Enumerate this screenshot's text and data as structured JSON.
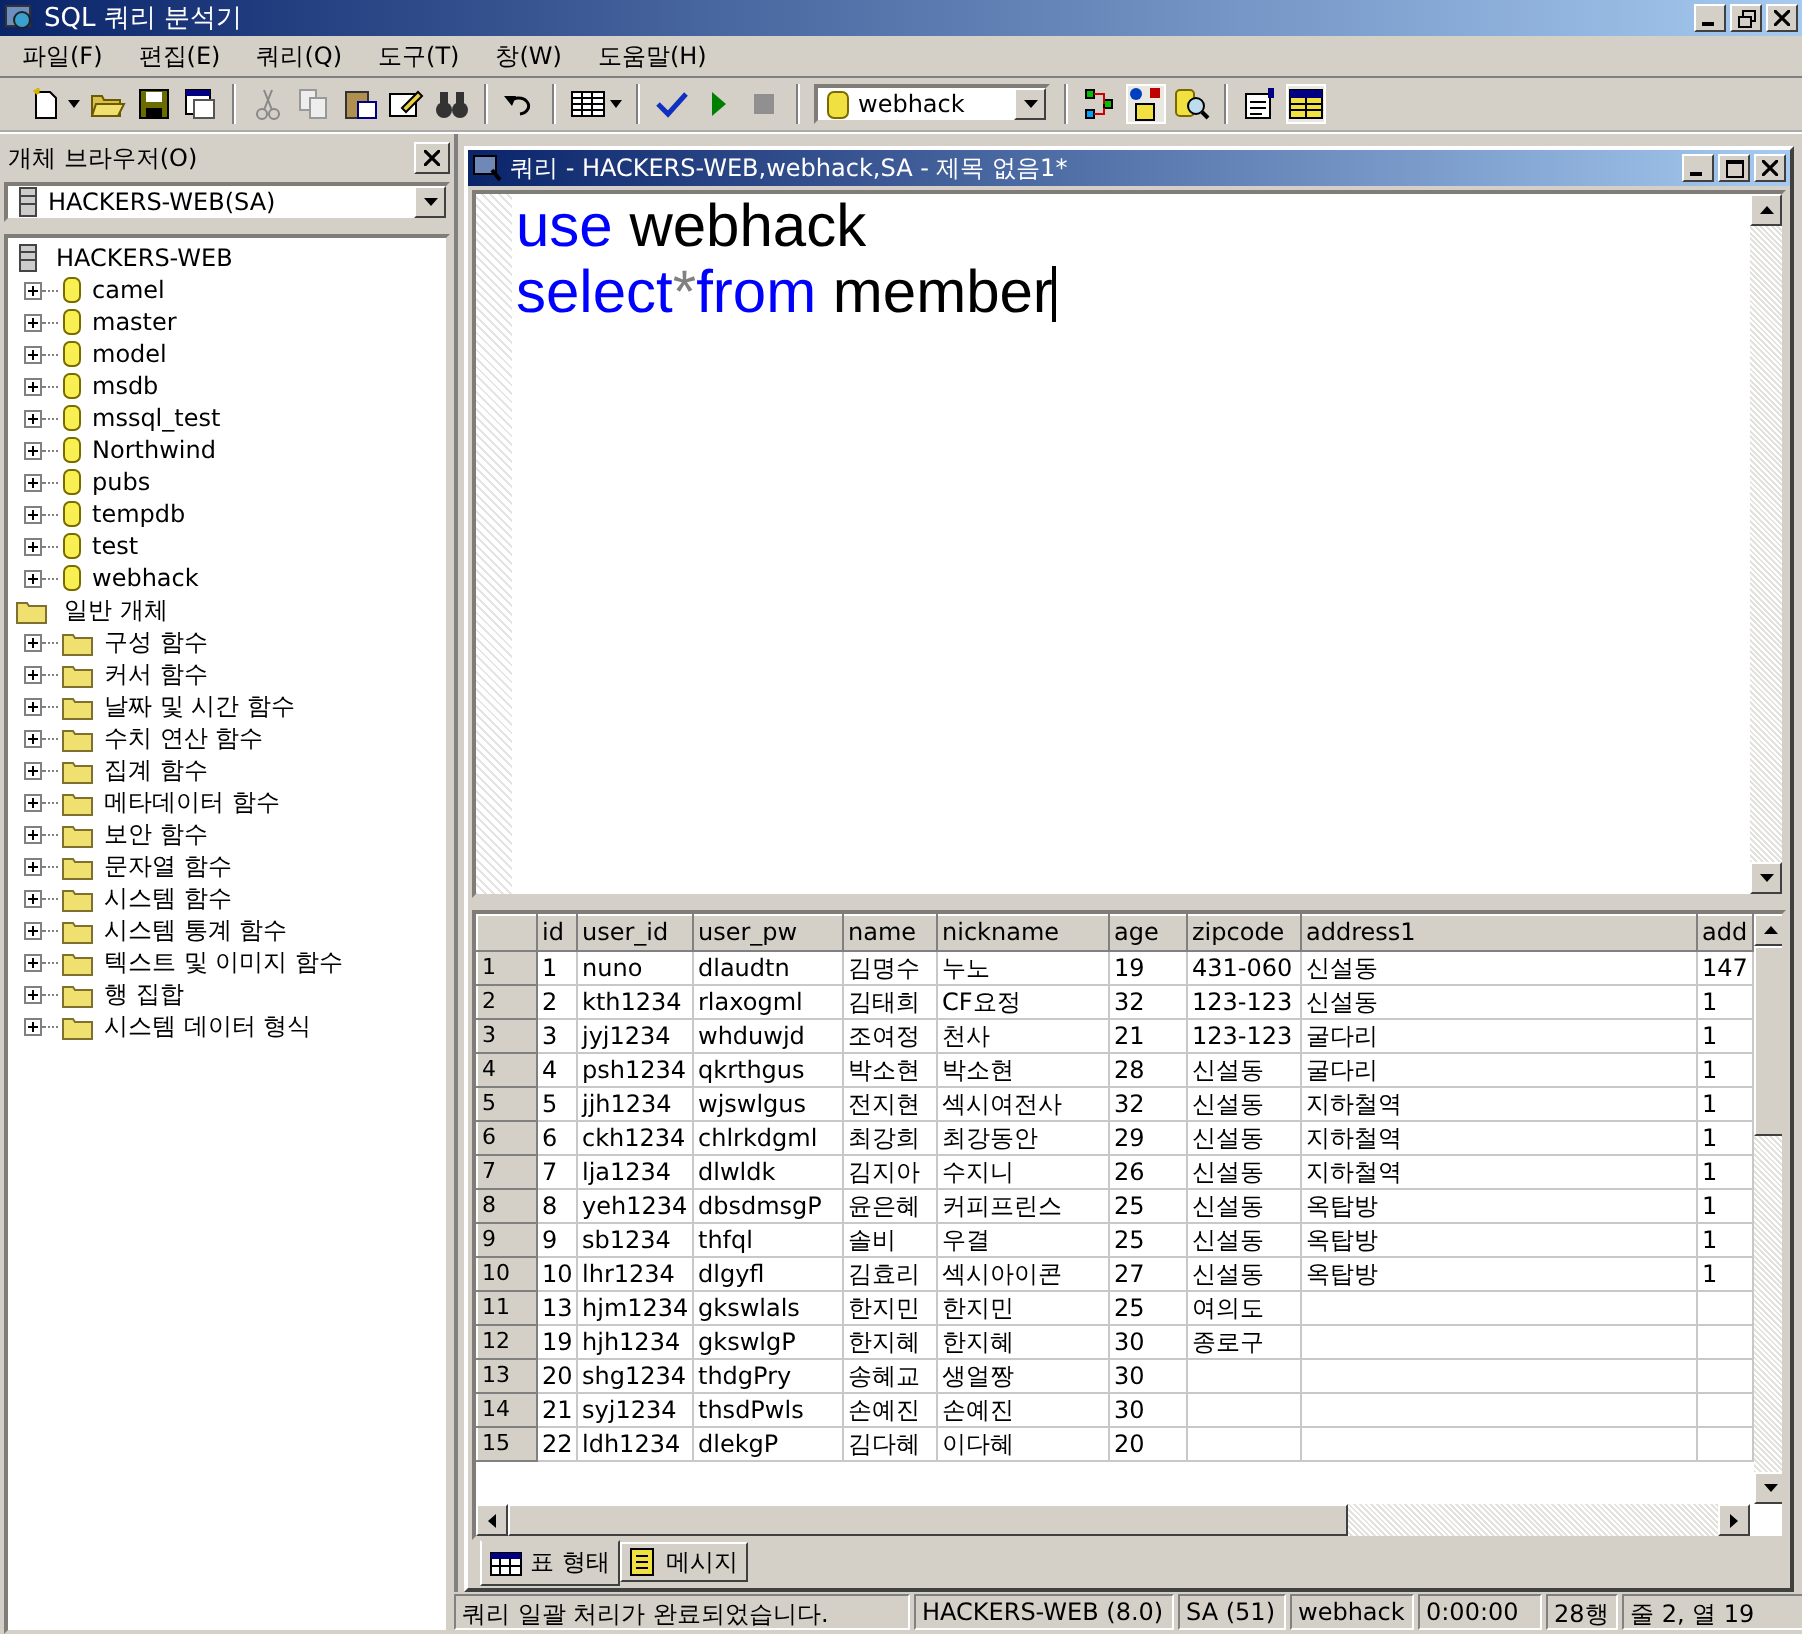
{
  "window": {
    "title": "SQL 쿼리 분석기"
  },
  "menu": [
    {
      "label": "파일(F)"
    },
    {
      "label": "편집(E)"
    },
    {
      "label": "쿼리(Q)"
    },
    {
      "label": "도구(T)"
    },
    {
      "label": "창(W)"
    },
    {
      "label": "도움말(H)"
    }
  ],
  "toolbar": {
    "database": "webhack"
  },
  "object_browser": {
    "title": "개체 브라우저(O)",
    "server_select": "HACKERS-WEB(SA)",
    "tree": [
      {
        "label": "HACKERS-WEB",
        "kind": "server",
        "children": [
          {
            "label": "camel",
            "kind": "database",
            "expanded": false
          },
          {
            "label": "master",
            "kind": "database",
            "expanded": false
          },
          {
            "label": "model",
            "kind": "database",
            "expanded": false
          },
          {
            "label": "msdb",
            "kind": "database",
            "expanded": false
          },
          {
            "label": "mssql_test",
            "kind": "database",
            "expanded": false
          },
          {
            "label": "Northwind",
            "kind": "database",
            "expanded": false
          },
          {
            "label": "pubs",
            "kind": "database",
            "expanded": false
          },
          {
            "label": "tempdb",
            "kind": "database",
            "expanded": false
          },
          {
            "label": "test",
            "kind": "database",
            "expanded": false
          },
          {
            "label": "webhack",
            "kind": "database",
            "expanded": false
          }
        ]
      },
      {
        "label": "일반 개체",
        "kind": "folder",
        "children": [
          {
            "label": "구성 함수",
            "kind": "folder",
            "expanded": false
          },
          {
            "label": "커서 함수",
            "kind": "folder",
            "expanded": false
          },
          {
            "label": "날짜 및 시간 함수",
            "kind": "folder",
            "expanded": false
          },
          {
            "label": "수치 연산 함수",
            "kind": "folder",
            "expanded": false
          },
          {
            "label": "집계 함수",
            "kind": "folder",
            "expanded": false
          },
          {
            "label": "메타데이터 함수",
            "kind": "folder",
            "expanded": false
          },
          {
            "label": "보안 함수",
            "kind": "folder",
            "expanded": false
          },
          {
            "label": "문자열 함수",
            "kind": "folder",
            "expanded": false
          },
          {
            "label": "시스템 함수",
            "kind": "folder",
            "expanded": false
          },
          {
            "label": "시스템 통계 함수",
            "kind": "folder",
            "expanded": false
          },
          {
            "label": "텍스트 및 이미지 함수",
            "kind": "folder",
            "expanded": false
          },
          {
            "label": "행 집합",
            "kind": "folder",
            "expanded": false
          },
          {
            "label": "시스템 데이터 형식",
            "kind": "folder",
            "expanded": false
          }
        ]
      }
    ]
  },
  "query_window": {
    "title": "쿼리 - HACKERS-WEB,webhack,SA - 제목 없음1*",
    "editor_lines": [
      [
        {
          "text": "use",
          "kind": "keyword"
        },
        {
          "text": " webhack",
          "kind": "plain"
        }
      ],
      [
        {
          "text": "select",
          "kind": "keyword"
        },
        {
          "text": "*",
          "kind": "operator"
        },
        {
          "text": "from",
          "kind": "keyword"
        },
        {
          "text": " member",
          "kind": "plain"
        }
      ]
    ],
    "grid": {
      "columns": [
        "id",
        "user_id",
        "user_pw",
        "name",
        "nickname",
        "age",
        "zipcode",
        "address1",
        "add"
      ],
      "rows": [
        {
          "row_number": "1",
          "cells": [
            "1",
            "nuno",
            "dlaudtn",
            "김명수",
            "누노",
            "19",
            "431-060",
            "신설동",
            "147"
          ]
        },
        {
          "row_number": "2",
          "cells": [
            "2",
            "kth1234",
            "rlaxogml",
            "김태희",
            "CF요정",
            "32",
            "123-123",
            "신설동",
            "1"
          ]
        },
        {
          "row_number": "3",
          "cells": [
            "3",
            "jyj1234",
            "whduwjd",
            "조여정",
            "천사",
            "21",
            "123-123",
            "굴다리",
            "1"
          ]
        },
        {
          "row_number": "4",
          "cells": [
            "4",
            "psh1234",
            "qkrthgus",
            "박소현",
            "박소현",
            "28",
            "신설동",
            "굴다리",
            "1"
          ]
        },
        {
          "row_number": "5",
          "cells": [
            "5",
            "jjh1234",
            "wjswlgus",
            "전지현",
            "섹시여전사",
            "32",
            "신설동",
            "지하철역",
            "1"
          ]
        },
        {
          "row_number": "6",
          "cells": [
            "6",
            "ckh1234",
            "chlrkdgml",
            "최강희",
            "최강동안",
            "29",
            "신설동",
            "지하철역",
            "1"
          ]
        },
        {
          "row_number": "7",
          "cells": [
            "7",
            "lja1234",
            "dlwldk",
            "김지아",
            "수지니",
            "26",
            "신설동",
            "지하철역",
            "1"
          ]
        },
        {
          "row_number": "8",
          "cells": [
            "8",
            "yeh1234",
            "dbsdmsgP",
            "윤은혜",
            "커피프린스",
            "25",
            "신설동",
            "옥탑방",
            "1"
          ]
        },
        {
          "row_number": "9",
          "cells": [
            "9",
            "sb1234",
            "thfql",
            "솔비",
            "우결",
            "25",
            "신설동",
            "옥탑방",
            "1"
          ]
        },
        {
          "row_number": "10",
          "cells": [
            "10",
            "lhr1234",
            "dlgyfl",
            "김효리",
            "섹시아이콘",
            "27",
            "신설동",
            "옥탑방",
            "1"
          ]
        },
        {
          "row_number": "11",
          "cells": [
            "13",
            "hjm1234",
            "gkswlals",
            "한지민",
            "한지민",
            "25",
            "여의도",
            "",
            ""
          ]
        },
        {
          "row_number": "12",
          "cells": [
            "19",
            "hjh1234",
            "gkswlgP",
            "한지혜",
            "한지혜",
            "30",
            "종로구",
            "",
            ""
          ]
        },
        {
          "row_number": "13",
          "cells": [
            "20",
            "shg1234",
            "thdgPry",
            "송혜교",
            "생얼짱",
            "30",
            "",
            "",
            ""
          ]
        },
        {
          "row_number": "14",
          "cells": [
            "21",
            "syj1234",
            "thsdPwls",
            "손예진",
            "손예진",
            "30",
            "",
            "",
            ""
          ]
        },
        {
          "row_number": "15",
          "cells": [
            "22",
            "ldh1234",
            "dlekgP",
            "김다혜",
            "이다혜",
            "20",
            "",
            "",
            ""
          ]
        }
      ]
    },
    "result_tabs": [
      {
        "label": "표 형태",
        "selected": true
      },
      {
        "label": "메시지",
        "selected": false
      }
    ]
  },
  "status_bar": [
    "쿼리 일괄 처리가 완료되었습니다.",
    "HACKERS-WEB (8.0)",
    "SA (51)",
    "webhack",
    "0:00:00",
    "28행",
    "줄 2, 열 19"
  ]
}
